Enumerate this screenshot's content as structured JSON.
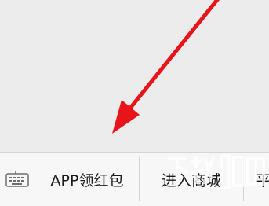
{
  "menu": {
    "items": [
      {
        "label": "APP领红包"
      },
      {
        "label": "进入商城"
      },
      {
        "label": "平"
      }
    ]
  },
  "icons": {
    "keyboard": "keyboard-icon",
    "annotation_arrow": "arrow-annotation"
  },
  "colors": {
    "annotation": "#e8141a",
    "menu_background": "#f7f7f7",
    "page_background": "#ececec"
  }
}
